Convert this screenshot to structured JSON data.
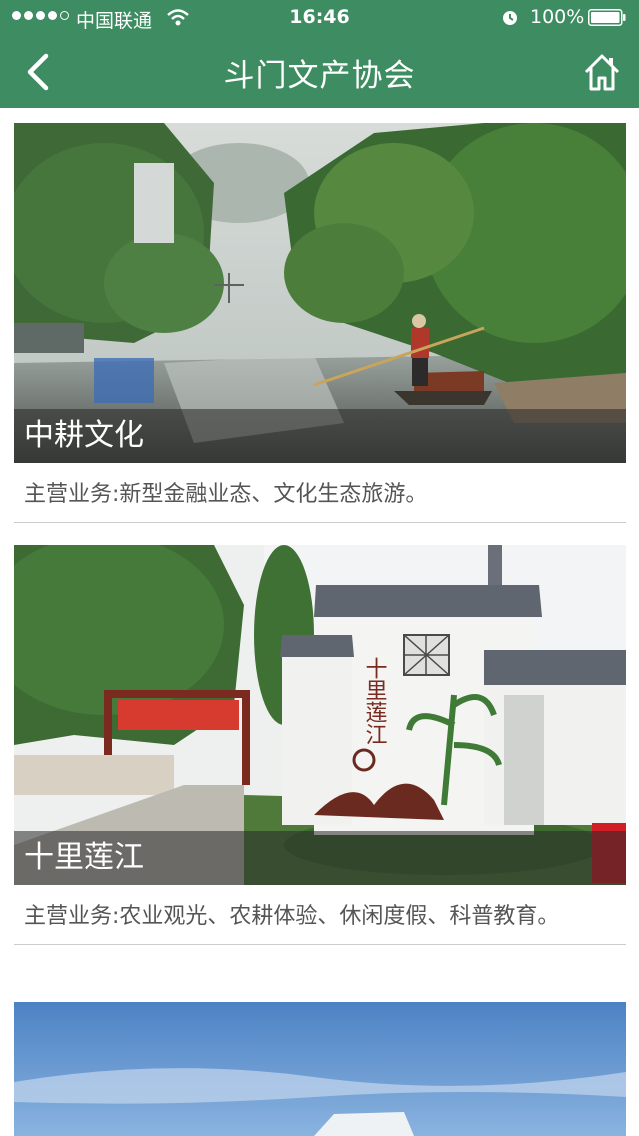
{
  "status_bar": {
    "carrier": "中国联通",
    "time": "16:46",
    "battery": "100%"
  },
  "header": {
    "title": "斗门文产协会",
    "back_icon": "back-chevron-icon",
    "home_icon": "home-icon"
  },
  "colors": {
    "header_bg": "#3d8c62",
    "caption_overlay": "rgba(40,40,40,0.55)",
    "description_text": "#555555"
  },
  "cards": [
    {
      "title": "中耕文化",
      "description": "主营业务:新型金融业态、文化生态旅游。"
    },
    {
      "title": "十里莲江",
      "description": "主营业务:农业观光、农耕体验、休闲度假、科普教育。",
      "sign_text": "十里莲江"
    },
    {
      "title": "",
      "description": ""
    }
  ]
}
